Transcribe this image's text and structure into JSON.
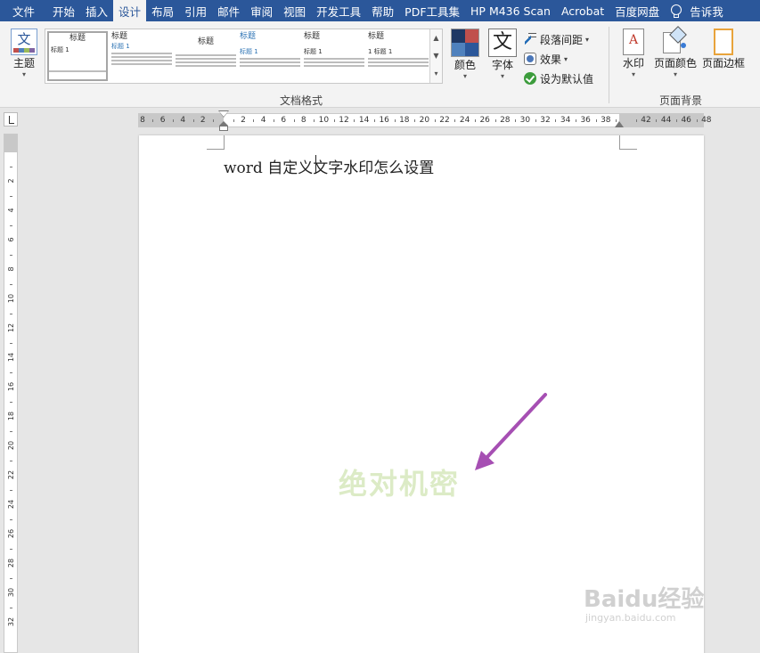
{
  "tabs": [
    "文件",
    "开始",
    "插入",
    "设计",
    "布局",
    "引用",
    "邮件",
    "审阅",
    "视图",
    "开发工具",
    "帮助",
    "PDF工具集",
    "HP M436 Scan",
    "Acrobat",
    "百度网盘"
  ],
  "active_tab": "设计",
  "tell_me": "告诉我",
  "ribbon": {
    "theme_label": "主题",
    "theme_icon_char": "文",
    "styles": [
      {
        "title": "标题",
        "sub": "标题 1"
      },
      {
        "title": "标题",
        "sub": "标题 1"
      },
      {
        "title": "标题",
        "sub": ""
      },
      {
        "title": "标题",
        "sub": "标题 1"
      },
      {
        "title": "标题",
        "sub": "标题 1"
      },
      {
        "title": "标题",
        "sub": "1 标题 1"
      }
    ],
    "doc_format_label": "文档格式",
    "colors_label": "颜色",
    "colors": [
      "#1f3864",
      "#c0504d",
      "#4f81bd",
      "#2b579a"
    ],
    "fonts_label": "字体",
    "fonts_icon_char": "文",
    "para_spacing_label": "段落间距",
    "effects_label": "效果",
    "set_default_label": "设为默认值",
    "watermark_label": "水印",
    "page_color_label": "页面颜色",
    "page_border_label": "页面边框",
    "page_bg_label": "页面背景"
  },
  "hruler_numbers": [
    "8",
    "6",
    "4",
    "2",
    "",
    "2",
    "4",
    "6",
    "8",
    "10",
    "12",
    "14",
    "16",
    "18",
    "20",
    "22",
    "24",
    "26",
    "28",
    "30",
    "32",
    "34",
    "36",
    "38",
    "",
    "42",
    "44",
    "46",
    "48"
  ],
  "vruler_numbers": [
    "2",
    "4",
    "6",
    "8",
    "10",
    "12",
    "14",
    "16",
    "18",
    "20",
    "22",
    "24",
    "26",
    "28",
    "30",
    "32"
  ],
  "document": {
    "text": "word 自定义文字水印怎么设置",
    "watermark": "绝对机密"
  },
  "baidu_logo": "Baidu经验",
  "baidu_url": "jingyan.baidu.com"
}
